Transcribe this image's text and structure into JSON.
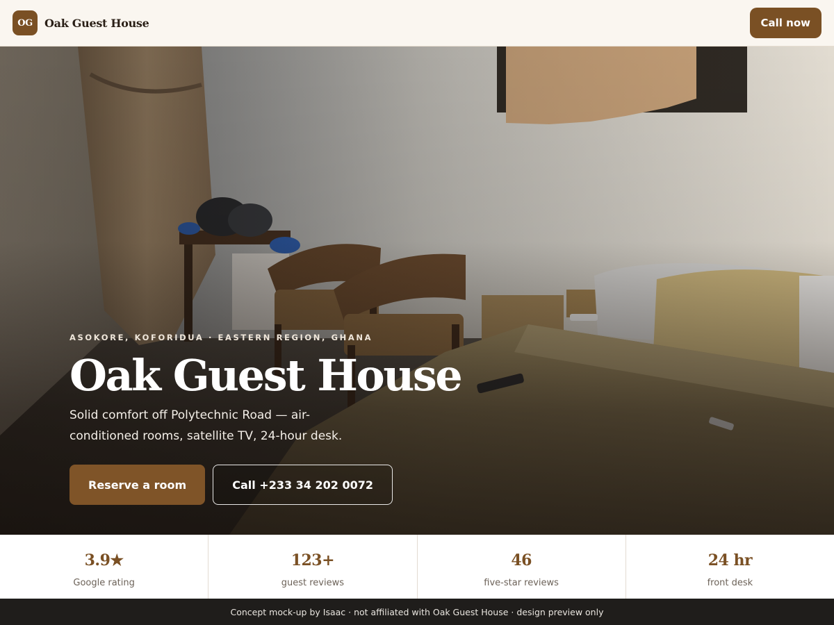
{
  "header": {
    "logo_initials": "OG",
    "brand_name": "Oak Guest House",
    "call_button": "Call now"
  },
  "hero": {
    "eyebrow": "ASOKORE, KOFORIDUA · EASTERN REGION, GHANA",
    "title": "Oak Guest House",
    "subtitle": "Solid comfort off Polytechnic Road — air-conditioned rooms, satellite TV, 24-hour desk.",
    "primary_button": "Reserve a room",
    "secondary_button": "Call +233 34 202 0072"
  },
  "stats": [
    {
      "value": "3.9★",
      "label": "Google rating"
    },
    {
      "value": "123+",
      "label": "guest reviews"
    },
    {
      "value": "46",
      "label": "five-star reviews"
    },
    {
      "value": "24 hr",
      "label": "front desk"
    }
  ],
  "footer": {
    "text": "Concept mock-up by Isaac · not affiliated with Oak Guest House · design preview only"
  },
  "colors": {
    "brand": "#7a5024",
    "header_bg": "#faf6f0",
    "footer_bg": "#1f1d1b"
  }
}
